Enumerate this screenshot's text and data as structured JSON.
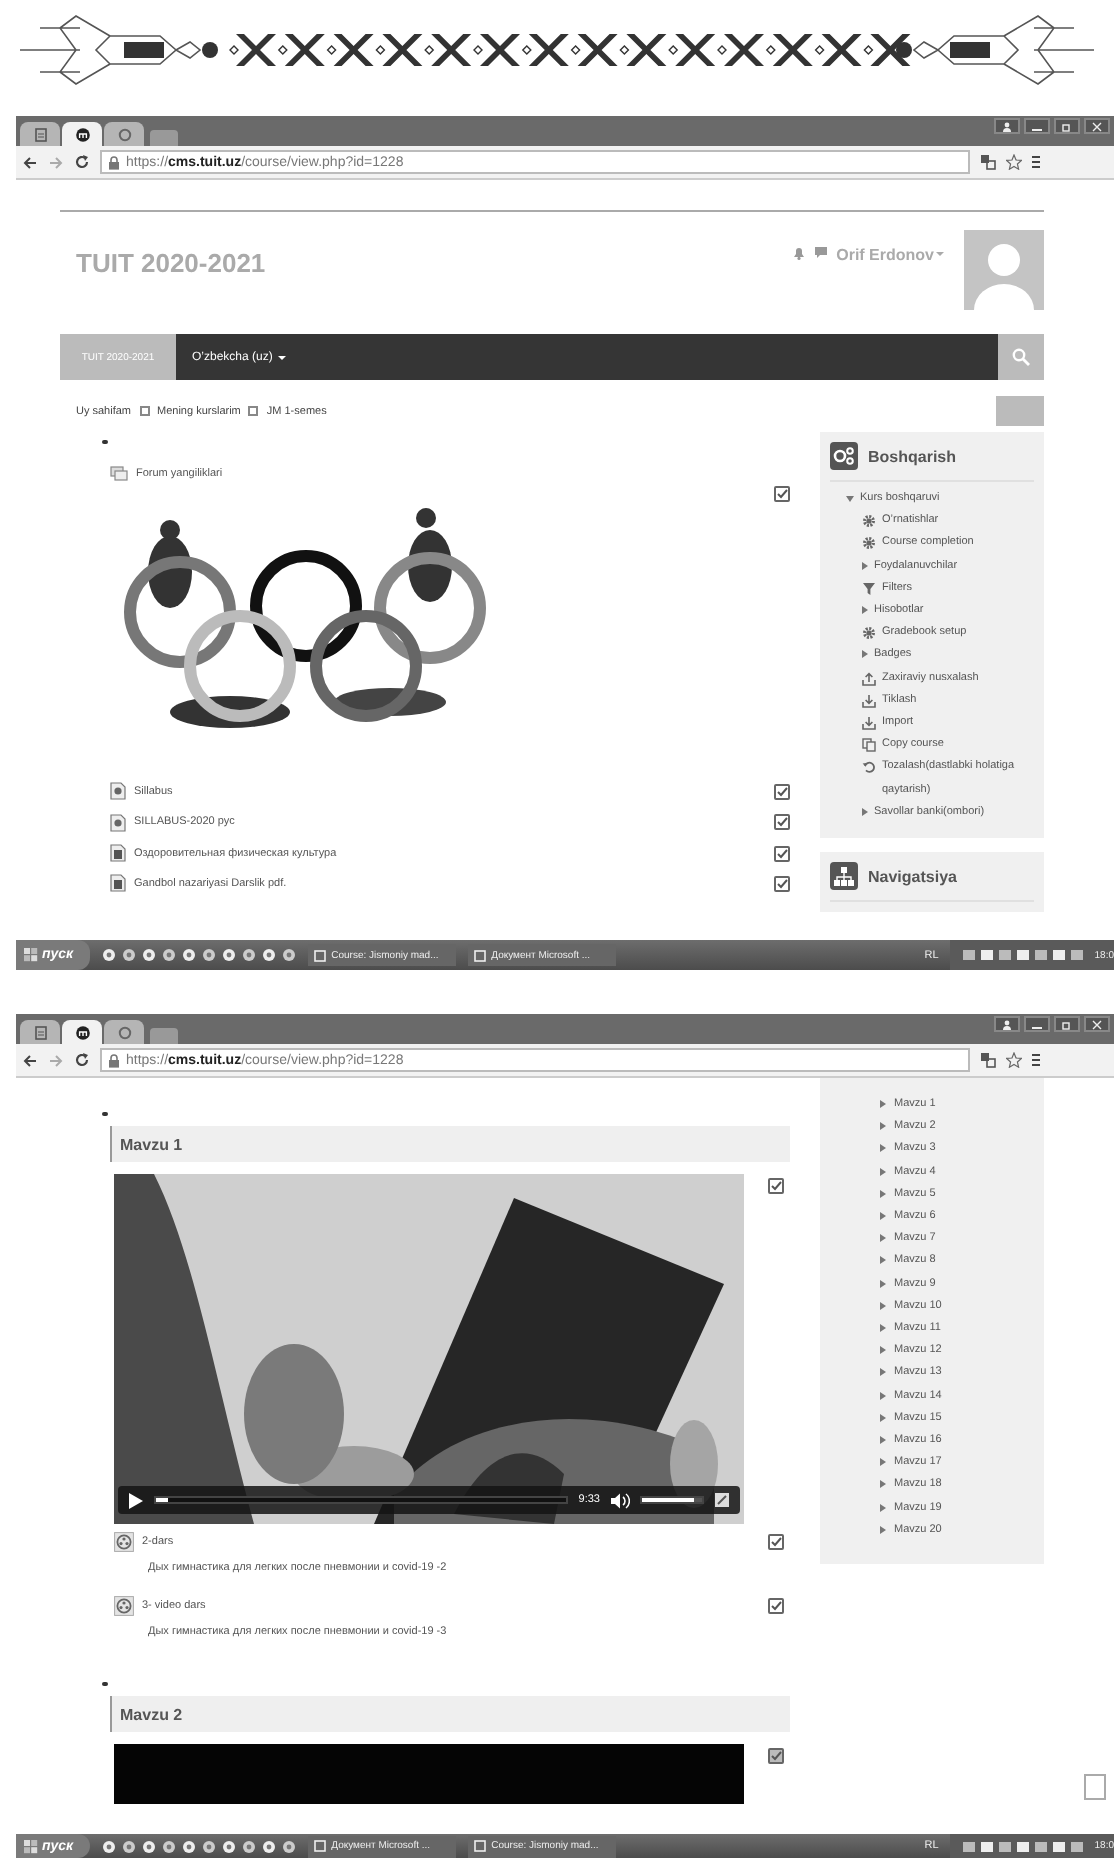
{
  "screenshots": [
    {
      "kind": "course_home",
      "browser": {
        "tabs": [
          {
            "selected": false
          },
          {
            "selected": true
          },
          {
            "selected": false
          }
        ],
        "url": "https://**cms.tuit.uz**/course/view.php?id=1228"
      },
      "site_title": "TUIT 2020-2021",
      "user_name": "Orif Erdonov",
      "navbar": [
        {
          "label": "TUIT 2020-2021",
          "kind": "brand"
        },
        {
          "label": "O’zbekcha (uz)",
          "kind": "menu"
        }
      ],
      "breadcrumb": [
        "Uy sahifam",
        "Mening kurslarim",
        "JM 1-semes"
      ],
      "activities": [
        {
          "kind": "forum",
          "title": "Forum yangiliklari"
        },
        {
          "kind": "picture",
          "checked": true
        },
        {
          "kind": "resource",
          "title": "Sillabus",
          "checked": true
        },
        {
          "kind": "resource",
          "title": "SILLABUS-2020 рус",
          "checked": true
        },
        {
          "kind": "document",
          "title": "Оздоровительная физическая культура",
          "checked": true
        },
        {
          "kind": "document",
          "title": "Gandbol nazariyasi Darslik pdf.",
          "checked": true
        }
      ],
      "blocks": [
        {
          "title": "Boshqarish",
          "items": [
            {
              "label": "Kurs boshqaruvi",
              "expanded": true,
              "children": [
                {
                  "label": "O’rnatishlar",
                  "kind": "gear"
                },
                {
                  "label": "Course completion",
                  "kind": "gear"
                },
                {
                  "label": "Foydalanuvchilar",
                  "kind": "caret",
                  "expanded": false
                },
                {
                  "label": "Filters",
                  "kind": "filter"
                },
                {
                  "label": "Hisobotlar",
                  "kind": "caret",
                  "expanded": false
                },
                {
                  "label": "Gradebook setup",
                  "kind": "gear"
                },
                {
                  "label": "Badges",
                  "kind": "caret",
                  "expanded": false
                },
                {
                  "label": "Zaxiraviy nusxalash",
                  "kind": "upload"
                },
                {
                  "label": "Tiklash",
                  "kind": "download"
                },
                {
                  "label": "Import",
                  "kind": "download"
                },
                {
                  "label": "Copy course",
                  "kind": "copy"
                },
                {
                  "label": "Tozalash(dastlabki holatiga qaytarish)",
                  "kind": "reset"
                },
                {
                  "label": "Savollar banki(ombori)",
                  "kind": "caret",
                  "expanded": false
                }
              ]
            }
          ]
        },
        {
          "title": "Navigatsiya"
        }
      ],
      "taskbar": {
        "start": "пуск",
        "tasks": [
          "Course: Jismoniy mad...",
          "Документ Microsoft ..."
        ],
        "language": "RL",
        "clock": "18:0"
      }
    },
    {
      "kind": "course_topics",
      "browser": {
        "tabs": [
          {
            "selected": false
          },
          {
            "selected": true
          },
          {
            "selected": false
          }
        ],
        "url": "https://**cms.tuit.uz**/course/view.php?id=1228"
      },
      "sections": [
        {
          "title": "Mavzu 1",
          "video": {
            "kind": "picture",
            "time": "9:33",
            "progress": {
              "level": 0.03
            },
            "volume": {
              "level": 0.88
            }
          },
          "checked": true,
          "activities": [
            {
              "title": "2-dars",
              "description": "Дых гимнастика для легких после пневмонии и covid-19 -2",
              "checked": true
            },
            {
              "title": "3- video dars",
              "description": "Дых гимнастика для легких после пневмонии и covid-19 -3",
              "checked": true
            }
          ]
        },
        {
          "title": "Mavzu 2",
          "video": {
            "kind": "blank"
          },
          "checked": true
        }
      ],
      "nav_items": [
        "Mavzu 1",
        "Mavzu 2",
        "Mavzu 3",
        "Mavzu 4",
        "Mavzu 5",
        "Mavzu 6",
        "Mavzu 7",
        "Mavzu 8",
        "Mavzu 9",
        "Mavzu 10",
        "Mavzu 11",
        "Mavzu 12",
        "Mavzu 13",
        "Mavzu 14",
        "Mavzu 15",
        "Mavzu 16",
        "Mavzu 17",
        "Mavzu 18",
        "Mavzu 19",
        "Mavzu 20"
      ],
      "side_checkbox": {
        "checked": false
      },
      "taskbar": {
        "start": "пуск",
        "tasks": [
          "Документ Microsoft ...",
          "Course: Jismoniy mad..."
        ],
        "language": "RL",
        "clock": "18:0"
      }
    }
  ]
}
